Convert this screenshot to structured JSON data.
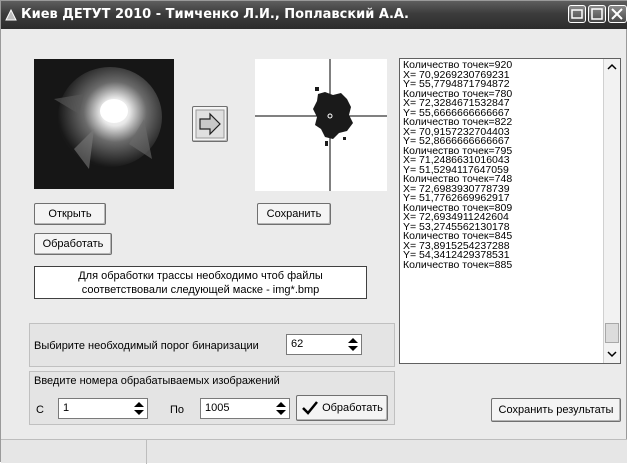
{
  "window": {
    "title": "Киев ДЕТУТ 2010 - Тимченко Л.И., Поплавский А.А.",
    "icon": "app-icon",
    "controls": [
      "minimize-icon",
      "maximize-icon",
      "close-icon"
    ]
  },
  "images": {
    "source_icon": "photo-image",
    "result_icon": "binary-image",
    "arrow_icon": "arrow-right-icon"
  },
  "buttons": {
    "open": "Открыть",
    "save": "Сохранить",
    "process": "Обработать",
    "process_batch": "Обработать",
    "save_results": "Сохранить результаты"
  },
  "message": "Для обработки трассы необходимо чтоб файлы соответствовали следующей маске - img*.bmp",
  "threshold": {
    "label": "Выбирите необходимый порог бинаризации",
    "value": "62"
  },
  "range": {
    "label": "Введите номера обрабатываемых изображений",
    "from_label": "С",
    "from_value": "1",
    "to_label": "По",
    "to_value": "1005"
  },
  "log_lines": [
    "Количество точек=920",
    "X= 70,9269230769231",
    "Y= 55,7794871794872",
    "Количество точек=780",
    "X= 72,3284671532847",
    "Y= 55,6666666666667",
    "Количество точек=822",
    "X= 70,9157232704403",
    "Y= 52,8666666666667",
    "Количество точек=795",
    "X= 71,2486631016043",
    "Y= 51,5294117647059",
    "Количество точек=748",
    "X= 72,6983930778739",
    "Y= 51,7762669962917",
    "Количество точек=809",
    "X= 72,6934911242604",
    "Y= 53,2745562130178",
    "Количество точек=845",
    "X= 73,8915254237288",
    "Y= 54,3412429378531",
    "Количество точек=885"
  ],
  "colors": {
    "titlebar": "#3c3c3c",
    "window_bg": "#ebebeb"
  }
}
